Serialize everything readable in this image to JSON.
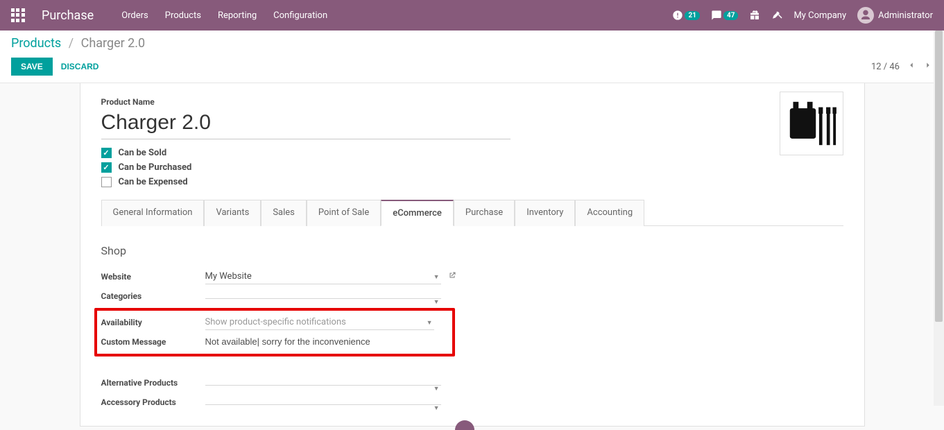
{
  "nav": {
    "brand": "Purchase",
    "menu": [
      "Orders",
      "Products",
      "Reporting",
      "Configuration"
    ],
    "activity_count": "21",
    "messages_count": "47",
    "company": "My Company",
    "user": "Administrator"
  },
  "breadcrumb": {
    "root": "Products",
    "current": "Charger 2.0"
  },
  "buttons": {
    "save": "SAVE",
    "discard": "DISCARD"
  },
  "pager": {
    "text": "12 / 46"
  },
  "form": {
    "product_name_label": "Product Name",
    "product_name": "Charger 2.0",
    "checks": {
      "sold": "Can be Sold",
      "purchased": "Can be Purchased",
      "expensed": "Can be Expensed"
    }
  },
  "tabs": [
    "General Information",
    "Variants",
    "Sales",
    "Point of Sale",
    "eCommerce",
    "Purchase",
    "Inventory",
    "Accounting"
  ],
  "ecommerce": {
    "section": "Shop",
    "labels": {
      "website": "Website",
      "categories": "Categories",
      "availability": "Availability",
      "custom_message": "Custom Message",
      "alternative": "Alternative Products",
      "accessory": "Accessory Products"
    },
    "values": {
      "website": "My Website",
      "categories": "",
      "availability": "Show product-specific notifications",
      "custom_message": "Not available| sorry for the inconvenience",
      "alternative": "",
      "accessory": ""
    }
  }
}
